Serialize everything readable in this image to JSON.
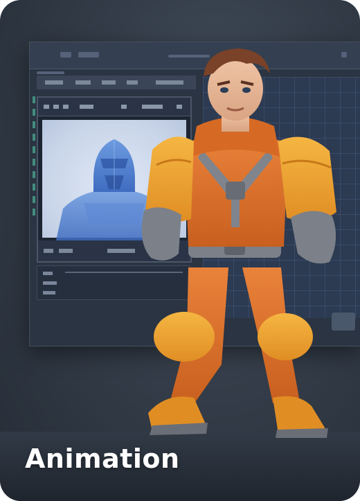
{
  "card": {
    "title": "Animation"
  },
  "colors": {
    "background": "#2f3844",
    "screen": "#2b3442",
    "grid": "#2c3a52",
    "jacket": "#e0782a",
    "sleeve": "#f0a83a",
    "gear": "#7c8088",
    "text": "#ffffff"
  },
  "icons": {
    "character": "3d-character-illustration",
    "screen": "animation-software-screen",
    "bust": "blue-3d-bust-model"
  }
}
